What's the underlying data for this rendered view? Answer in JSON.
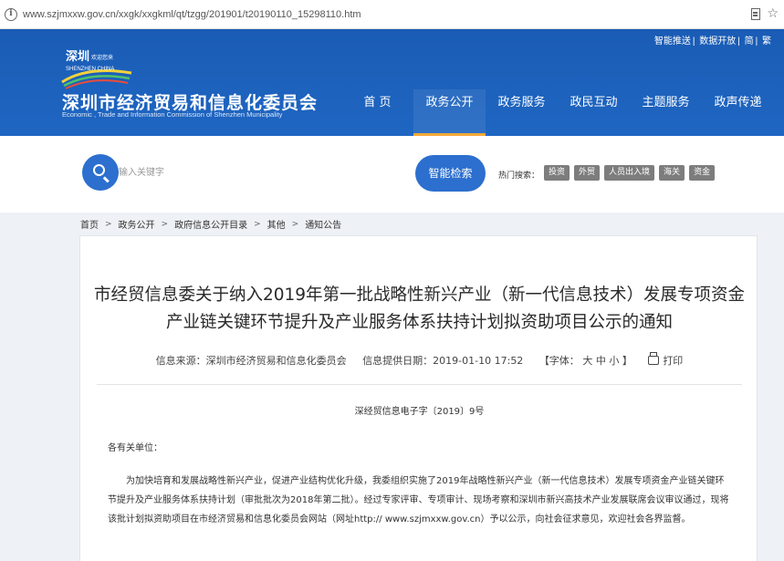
{
  "browser": {
    "url": "www.szjmxxw.gov.cn/xxgk/xxgkml/qt/tzgg/201901/t20190110_15298110.htm"
  },
  "header": {
    "toplinks": [
      "智能推送",
      "数据开放",
      "简",
      "繁"
    ],
    "logo_text": "深圳 欢迎您来 SHENZHEN CHINA",
    "site_title": "深圳市经济贸易和信息化委员会",
    "site_subtitle": "Economic , Trade and Information Commission of Shenzhen Municipality",
    "nav": [
      "首 页",
      "政务公开",
      "政务服务",
      "政民互动",
      "主题服务",
      "政声传递"
    ],
    "nav_active_index": 1,
    "colors": {
      "header_bg": "#1f66c2",
      "accent": "#f3a83a"
    }
  },
  "search": {
    "placeholder": "输入关键字",
    "button_label": "智能检索",
    "hot_label": "热门搜索：",
    "hot_tags": [
      "投资",
      "外贸",
      "人员出入境",
      "海关",
      "资金"
    ]
  },
  "breadcrumb": [
    "首页",
    "政务公开",
    "政府信息公开目录",
    "其他",
    "通知公告"
  ],
  "article": {
    "title": "市经贸信息委关于纳入2019年第一批战略性新兴产业（新一代信息技术）发展专项资金产业链关键环节提升及产业服务体系扶持计划拟资助项目公示的通知",
    "source": "信息来源：深圳市经济贸易和信息化委员会",
    "date": "信息提供日期：2019-01-10 17:52",
    "font_size_label": "【字体：",
    "font_sizes": [
      "大",
      "中",
      "小"
    ],
    "font_size_close": "】",
    "print_label": "打印",
    "doc_number": "深经贸信息电子字〔2019〕9号",
    "salutation": "各有关单位：",
    "body": "为加快培育和发展战略性新兴产业，促进产业结构优化升级，我委组织实施了2019年战略性新兴产业（新一代信息技术）发展专项资金产业链关键环节提升及产业服务体系扶持计划（审批批次为2018年第二批）。经过专家评审、专项审计、现场考察和深圳市新兴高技术产业发展联席会议审议通过，现将该批计划拟资助项目在市经济贸易和信息化委员会网站（网址http:// www.szjmxxw.gov.cn）予以公示，向社会征求意见，欢迎社会各界监督。"
  }
}
